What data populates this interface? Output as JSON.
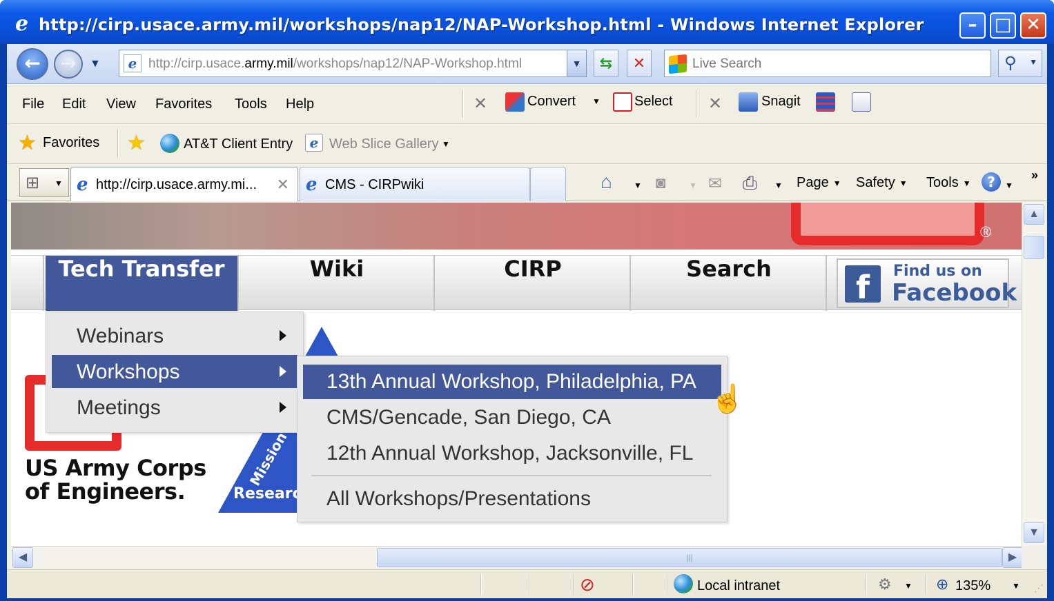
{
  "window": {
    "title": "http://cirp.usace.army.mil/workshops/nap12/NAP-Workshop.html - Windows Internet Explorer",
    "min_glyph": "–",
    "max_glyph": "□",
    "close_glyph": "✕"
  },
  "address_bar": {
    "url_prefix": "http://cirp.usace.",
    "url_domain": "army.mil",
    "url_suffix": "/workshops/nap12/NAP-Workshop.html",
    "search_placeholder": "Live Search"
  },
  "menu": [
    "File",
    "Edit",
    "View",
    "Favorites",
    "Tools",
    "Help"
  ],
  "toolbar": {
    "convert_label": "Convert",
    "select_label": "Select",
    "snagit_label": "Snagit"
  },
  "favorites_bar": {
    "favorites_label": "Favorites",
    "att_label": "AT&T Client Entry",
    "webslice_label": "Web Slice Gallery"
  },
  "tabs": [
    {
      "label": "http://cirp.usace.army.mi...",
      "active": true
    },
    {
      "label": "CMS - CIRPwiki",
      "active": false
    }
  ],
  "command_bar": {
    "page_label": "Page",
    "safety_label": "Safety",
    "tools_label": "Tools"
  },
  "site_nav": {
    "items": [
      "Tech Transfer",
      "Wiki",
      "CIRP",
      "Search"
    ],
    "active": "Tech Transfer",
    "facebook_line1": "Find us on",
    "facebook_line2": "Facebook"
  },
  "dropdown": {
    "items": [
      "Webinars",
      "Workshops",
      "Meetings"
    ],
    "highlighted": "Workshops"
  },
  "submenu": {
    "items": [
      "13th Annual Workshop, Philadelphia, PA",
      "CMS/Gencade, San Diego, CA",
      "12th Annual Workshop, Jacksonville, FL",
      "All Workshops/Presentations"
    ],
    "highlighted": "13th Annual Workshop, Philadelphia, PA"
  },
  "page": {
    "corps_line1": "US Army Corps",
    "corps_line2": "of Engineers.",
    "mission_text": "Mission",
    "research_text": "Researc"
  },
  "status_bar": {
    "zone": "Local intranet",
    "zoom": "135%"
  },
  "colors": {
    "nav_active": "#43589a",
    "facebook_blue": "#3b5b99",
    "corps_red": "#e62b2b"
  }
}
